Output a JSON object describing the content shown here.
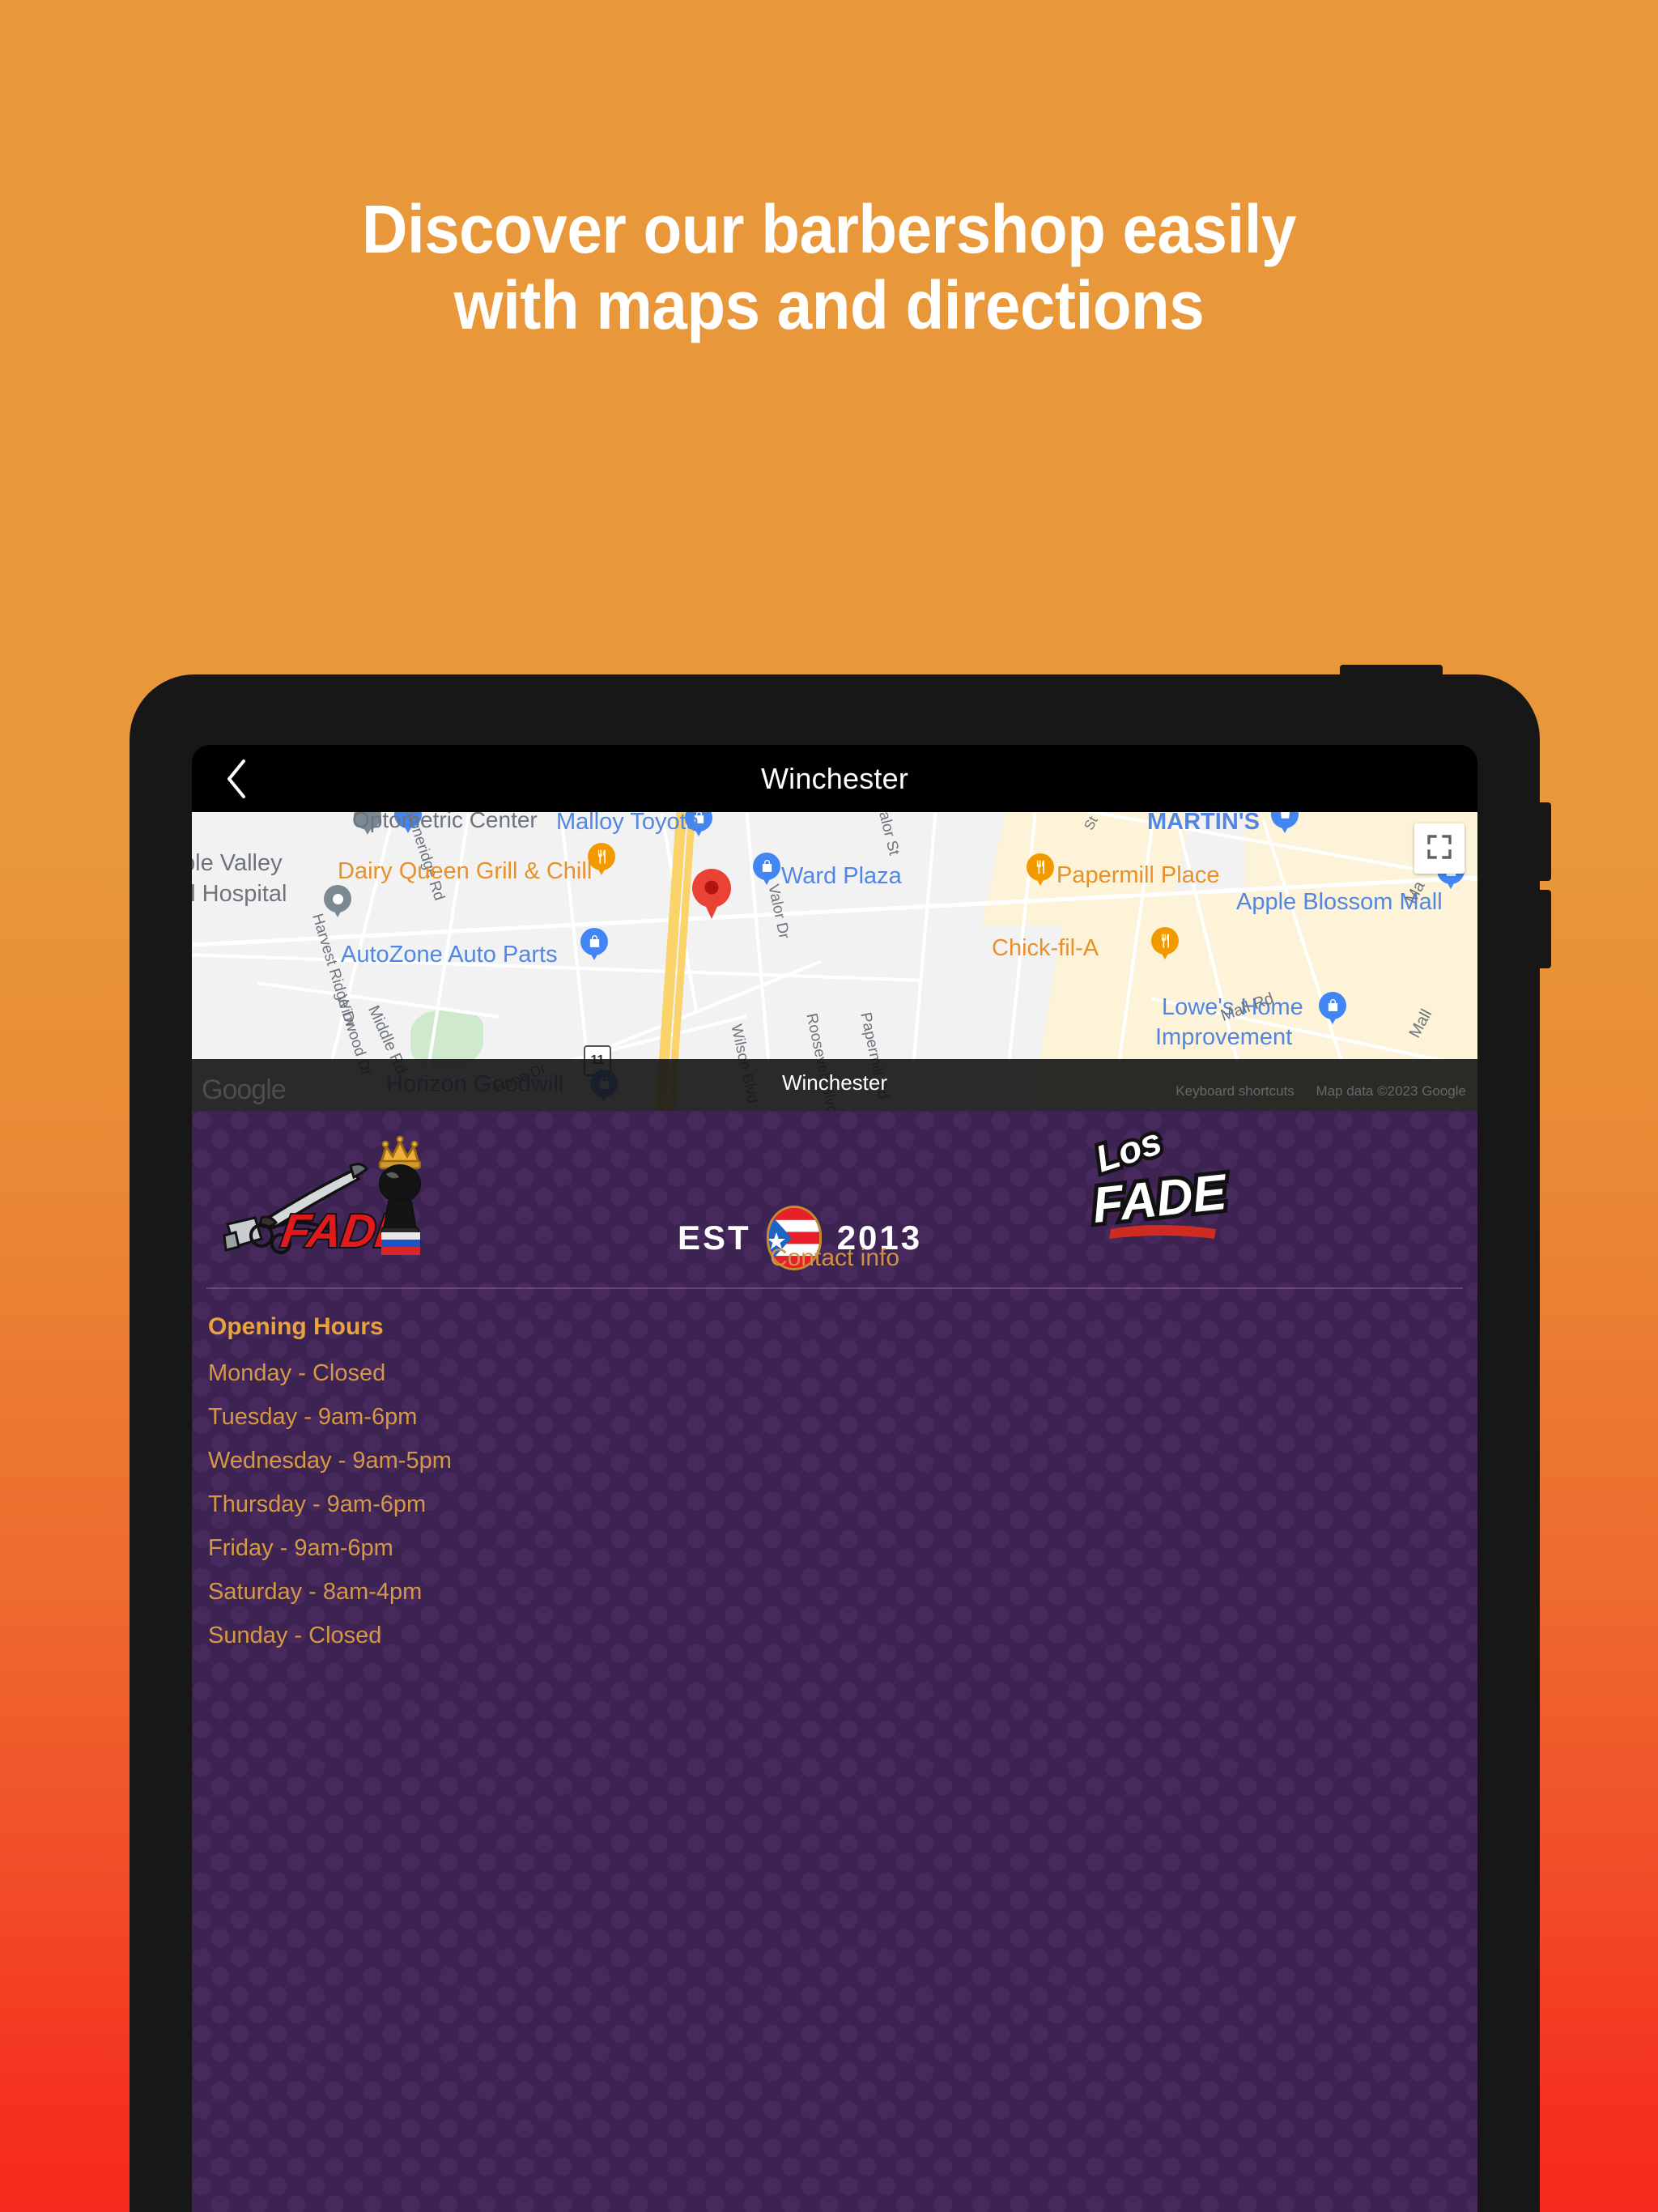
{
  "promo": {
    "headline_line1": "Discover our barbershop easily",
    "headline_line2": "with maps and directions",
    "bg_top_color": "#e8983a",
    "bg_bottom_color": "#f62a1c"
  },
  "app": {
    "appbar": {
      "title": "Winchester",
      "back_icon": "chevron-left-icon"
    },
    "map": {
      "city_label": "Winchester",
      "watermark": "Google",
      "keyboard_shortcuts": "Keyboard shortcuts",
      "map_data": "Map data ©2023 Google",
      "fullscreen_icon": "fullscreen-icon",
      "highway_shield": "11",
      "labels": [
        {
          "text": "Optometric Center",
          "color": "grey"
        },
        {
          "text": "Malloy Toyota",
          "color": "blue"
        },
        {
          "text": "MARTIN'S",
          "color": "blue"
        },
        {
          "text": "Valor St",
          "color": "grey"
        },
        {
          "text": "ple Valley",
          "color": "grey"
        },
        {
          "text": "al Hospital",
          "color": "grey"
        },
        {
          "text": "Stoneridge Rd",
          "color": "grey"
        },
        {
          "text": "Dairy Queen Grill & Chill",
          "color": "orange"
        },
        {
          "text": "Ward Plaza",
          "color": "blue"
        },
        {
          "text": "Papermill Place",
          "color": "orange"
        },
        {
          "text": "Apple Blossom Mall",
          "color": "blue"
        },
        {
          "text": "AutoZone Auto Parts",
          "color": "blue"
        },
        {
          "text": "Chick-fil-A",
          "color": "orange"
        },
        {
          "text": "Harvest Ridge Dr",
          "color": "grey"
        },
        {
          "text": "Winwood Dr",
          "color": "grey"
        },
        {
          "text": "Middle Rd",
          "color": "grey"
        },
        {
          "text": "Hope Dr",
          "color": "grey"
        },
        {
          "text": "Wilson Blvd",
          "color": "grey"
        },
        {
          "text": "Roosevelt Blvd",
          "color": "grey"
        },
        {
          "text": "Papermill Rd",
          "color": "grey"
        },
        {
          "text": "Lowe's Home",
          "color": "blue"
        },
        {
          "text": "Improvement",
          "color": "blue"
        },
        {
          "text": "Horizon Goodwill",
          "color": "blue"
        },
        {
          "text": "Mall Rd",
          "color": "grey"
        },
        {
          "text": "Mall",
          "color": "grey"
        },
        {
          "text": "Ma",
          "color": "grey"
        },
        {
          "text": "St",
          "color": "grey"
        },
        {
          "text": "Valor Dr",
          "color": "grey"
        }
      ]
    },
    "shop": {
      "logo_left_name": "fade-graffiti-logo",
      "logo_right_name": "los-fade-graffiti-logo",
      "est_label": "EST",
      "est_year": "2013",
      "flag_name": "puerto-rico-flag-icon",
      "contact_info_label": "Contact info"
    },
    "hours": {
      "title": "Opening Hours",
      "rows": [
        "Monday - Closed",
        "Tuesday - 9am-6pm",
        "Wednesday - 9am-5pm",
        "Thursday - 9am-6pm",
        "Friday - 9am-6pm",
        "Saturday - 8am-4pm",
        "Sunday - Closed"
      ]
    },
    "colors": {
      "purple_bg": "#3d2352",
      "purple_dot": "#48295e",
      "gold_text": "#d59844",
      "gold_heading": "#e8a33d"
    }
  }
}
